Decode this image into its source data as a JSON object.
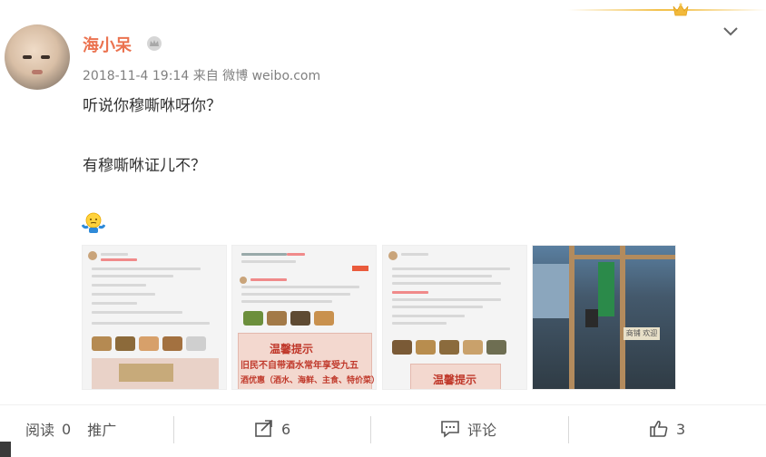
{
  "post": {
    "username": "海小呆",
    "timestamp": "2018-11-4 19:14",
    "source_prefix": "来自",
    "source": "微博 weibo.com",
    "lines": [
      "听说你穆嘶咻呀你？",
      "有穆嘶咻证儿不？"
    ],
    "emoji": "shrug-emoji"
  },
  "images": [
    {
      "name": "screenshot-1"
    },
    {
      "name": "screenshot-2",
      "sign_text_1": "温馨提示",
      "sign_text_2": "旧民不自带酒水常年享受九五",
      "sign_text_3": "酒优惠（酒水、海鲜、主食、特价菜）"
    },
    {
      "name": "screenshot-3",
      "sign_text_1": "温馨提示"
    },
    {
      "name": "door-photo",
      "sign_text": "商铺 欢迎"
    }
  ],
  "actions": {
    "read_label": "阅读",
    "read_count": "0",
    "promote_label": "推广",
    "forward_count": "6",
    "comment_label": "评论",
    "like_count": "3"
  },
  "colors": {
    "username": "#eb7350",
    "meta": "#808080",
    "text": "#333333"
  }
}
